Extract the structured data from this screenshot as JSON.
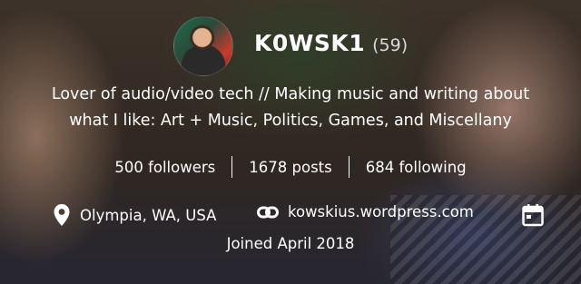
{
  "profile": {
    "username": "K0WSK1",
    "score": "(59)",
    "bio_line1": "Lover of audio/video tech // Making music and writing about",
    "bio_line2": "what I like: Art + Music, Politics, Games, and Miscellany"
  },
  "stats": {
    "followers": "500 followers",
    "posts": "1678 posts",
    "following": "684 following"
  },
  "meta": {
    "location": "Olympia, WA, USA",
    "website": "kowskius.wordpress.com",
    "joined": "Joined April 2018"
  },
  "icons": {
    "location": "map-pin-icon",
    "link": "link-icon",
    "calendar": "calendar-icon"
  },
  "colors": {
    "text": "#ffffff",
    "score": "#d9d9d9"
  }
}
